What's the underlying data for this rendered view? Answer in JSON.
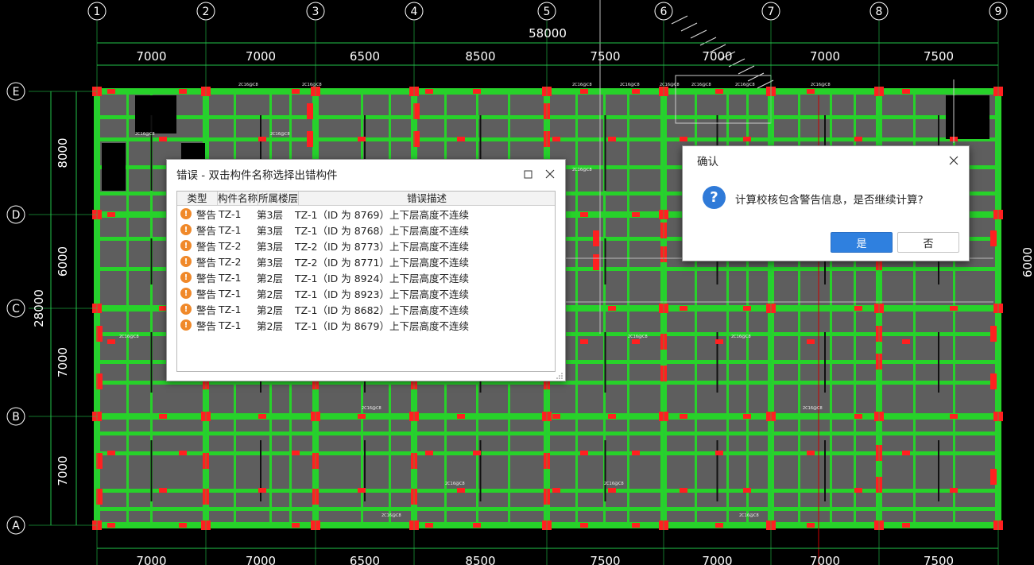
{
  "drawing": {
    "axes_top": [
      "1",
      "2",
      "3",
      "4",
      "5",
      "6",
      "7",
      "8",
      "9"
    ],
    "axes_left": [
      "E",
      "D",
      "C",
      "B",
      "A"
    ],
    "top_total": "58000",
    "top_dims": [
      "7000",
      "7000",
      "6500",
      "8500",
      "7500",
      "7000",
      "7000",
      "7500"
    ],
    "bottom_dims": [
      "7000",
      "7000",
      "6500",
      "8500",
      "7500",
      "7000",
      "7000",
      "7500"
    ],
    "left_total": "28000",
    "left_dims": [
      "8000",
      "6000",
      "7000",
      "7000"
    ],
    "right_dim": "6000",
    "colors": {
      "beam": "#27d22a",
      "slab": "#5e5e5e",
      "column": "#ff2020",
      "grid": "#22c44a",
      "axis": "#ffffff"
    }
  },
  "error_window": {
    "title": "错误 - 双击构件名称选择出错构件",
    "headers": {
      "type": "类型",
      "name": "构件名称",
      "floor": "所属楼层",
      "desc": "错误描述"
    },
    "rows": [
      {
        "type": "警告",
        "name": "TZ-1",
        "floor": "第3层",
        "desc": "TZ-1（ID 为 8769）上下层高度不连续"
      },
      {
        "type": "警告",
        "name": "TZ-1",
        "floor": "第3层",
        "desc": "TZ-1（ID 为 8768）上下层高度不连续"
      },
      {
        "type": "警告",
        "name": "TZ-2",
        "floor": "第3层",
        "desc": "TZ-2（ID 为 8773）上下层高度不连续"
      },
      {
        "type": "警告",
        "name": "TZ-2",
        "floor": "第3层",
        "desc": "TZ-2（ID 为 8771）上下层高度不连续"
      },
      {
        "type": "警告",
        "name": "TZ-1",
        "floor": "第2层",
        "desc": "TZ-1（ID 为 8924）上下层高度不连续"
      },
      {
        "type": "警告",
        "name": "TZ-1",
        "floor": "第2层",
        "desc": "TZ-1（ID 为 8923）上下层高度不连续"
      },
      {
        "type": "警告",
        "name": "TZ-1",
        "floor": "第2层",
        "desc": "TZ-1（ID 为 8682）上下层高度不连续"
      },
      {
        "type": "警告",
        "name": "TZ-1",
        "floor": "第2层",
        "desc": "TZ-1（ID 为 8679）上下层高度不连续"
      }
    ]
  },
  "confirm_dialog": {
    "title": "确认",
    "message": "计算校核包含警告信息，是否继续计算?",
    "yes_label": "是",
    "no_label": "否"
  }
}
